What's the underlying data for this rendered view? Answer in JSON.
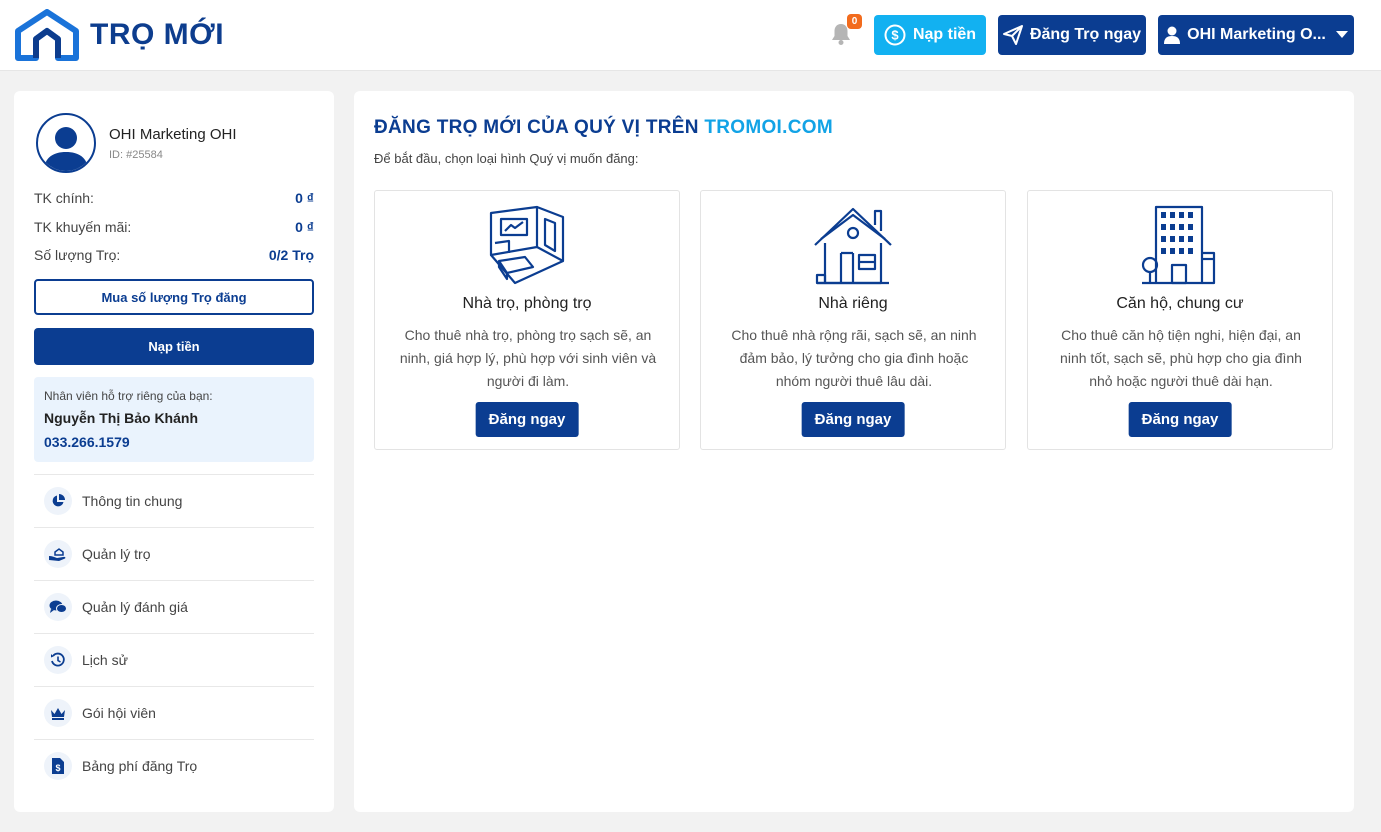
{
  "brand": {
    "name": "TRỌ MỚI"
  },
  "header": {
    "notification_count": "0",
    "topup_label": "Nạp tiền",
    "post_label": "Đăng Trọ ngay",
    "user_label": "OHI Marketing O..."
  },
  "sidebar": {
    "user_name": "OHI Marketing OHI",
    "user_id": "ID: #25584",
    "stats": [
      {
        "label": "TK chính:",
        "value": "0 ₫"
      },
      {
        "label": "TK khuyến mãi:",
        "value": "0 ₫"
      },
      {
        "label": "Số lượng Trọ:",
        "value": "0/2 Trọ"
      }
    ],
    "buy_button": "Mua số lượng Trọ đăng",
    "topup_button": "Nạp tiền",
    "support": {
      "title": "Nhân viên hỗ trợ riêng của bạn:",
      "name": "Nguyễn Thị Bảo Khánh",
      "phone": "033.266.1579"
    },
    "menu": [
      {
        "label": "Thông tin chung",
        "icon": "pie-chart-icon"
      },
      {
        "label": "Quản lý trọ",
        "icon": "hand-house-icon"
      },
      {
        "label": "Quản lý đánh giá",
        "icon": "chat-bubbles-icon"
      },
      {
        "label": "Lịch sử",
        "icon": "history-icon"
      },
      {
        "label": "Gói hội viên",
        "icon": "crown-icon"
      },
      {
        "label": "Bảng phí đăng Trọ",
        "icon": "fee-document-icon"
      }
    ]
  },
  "main": {
    "title": "ĐĂNG TRỌ MỚI CỦA QUÝ VỊ TRÊN",
    "title_highlight": "TROMOI.COM",
    "subtitle": "Để bắt đầu, chọn loại hình Quý vị muốn đăng:",
    "cards": [
      {
        "title": "Nhà trọ, phòng trọ",
        "description": "Cho thuê nhà trọ, phòng trọ sạch sẽ, an ninh, giá hợp lý, phù hợp với sinh viên và người đi làm.",
        "button": "Đăng ngay",
        "icon": "room-interior-icon"
      },
      {
        "title": "Nhà riêng",
        "description": "Cho thuê nhà rộng rãi, sạch sẽ, an ninh đảm bảo, lý tưởng cho gia đình hoặc nhóm người thuê lâu dài.",
        "button": "Đăng ngay",
        "icon": "house-icon"
      },
      {
        "title": "Căn hộ, chung cư",
        "description": "Cho thuê căn hộ tiện nghi, hiện đại, an ninh tốt, sạch sẽ, phù hợp cho gia đình nhỏ hoặc người thuê dài hạn.",
        "button": "Đăng ngay",
        "icon": "apartment-building-icon"
      }
    ]
  },
  "colors": {
    "primary": "#0b3d91",
    "accent": "#12b1f1",
    "badge": "#f26b1d"
  }
}
